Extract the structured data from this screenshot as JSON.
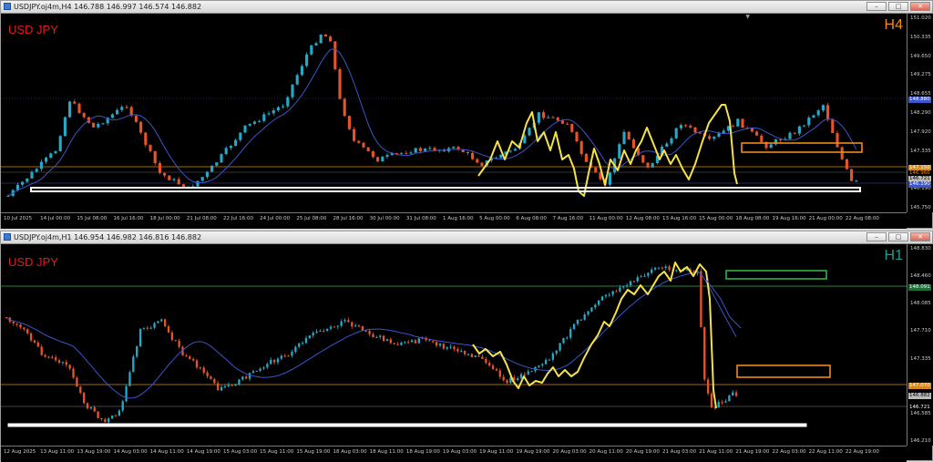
{
  "colors": {
    "bull": "#26a9c9",
    "bear": "#e8542a",
    "ma": "#3b55c8",
    "zigzag": "#f5e14a",
    "support": "#ffffff",
    "orange_box": "#f08a1c",
    "green_box": "#2fb24a",
    "orange_line": "#d7891f",
    "blue_label": "#3a55d0",
    "gray_label": "#bbbbbb"
  },
  "icons": {
    "window": "chart-window-icon",
    "minimize": "minimize-icon",
    "maximize": "maximize-icon",
    "close": "close-icon"
  },
  "top_window": {
    "title": "USDJPY.oj4m,H4  146.788 146.997 146.574 146.882",
    "symbol": "USD JPY",
    "timeframe": "H4",
    "price_axis": [
      "151.020",
      "150.335",
      "149.650",
      "149.275",
      "148.655",
      "148.290",
      "147.920",
      "147.335",
      "146.840",
      "146.190",
      "145.750"
    ],
    "price_labels": {
      "blue": "148.880",
      "orange1": "147.150",
      "orange2": "146.966",
      "gray": "146.721",
      "blue2": "146.190"
    },
    "time_axis": [
      "10 Jul 2025",
      "14 Jul 00:00",
      "15 Jul 08:00",
      "16 Jul 16:00",
      "18 Jul 00:00",
      "21 Jul 08:00",
      "22 Jul 16:00",
      "24 Jul 00:00",
      "25 Jul 08:00",
      "28 Jul 16:00",
      "30 Jul 00:00",
      "31 Jul 08:00",
      "1 Aug 16:00",
      "5 Aug 00:00",
      "6 Aug 08:00",
      "7 Aug 16:00",
      "11 Aug 00:00",
      "12 Aug 08:00",
      "13 Aug 16:00",
      "15 Aug 00:00",
      "18 Aug 08:00",
      "19 Aug 16:00",
      "21 Aug 00:00",
      "22 Aug 08:00"
    ]
  },
  "bottom_window": {
    "title": "USDJPY.oj4m,H1  146.954 146.982 146.816 146.882",
    "symbol": "USD JPY",
    "timeframe": "H1",
    "price_axis": [
      "148.830",
      "148.460",
      "148.085",
      "147.710",
      "147.335",
      "146.960",
      "146.585",
      "146.210"
    ],
    "price_labels": {
      "green": "148.091",
      "orange": "147.070",
      "gray1": "146.882",
      "gray2": "146.721"
    },
    "time_axis": [
      "12 Aug 2025",
      "13 Aug 11:00",
      "13 Aug 19:00",
      "14 Aug 03:00",
      "14 Aug 11:00",
      "14 Aug 19:00",
      "15 Aug 03:00",
      "15 Aug 11:00",
      "15 Aug 19:00",
      "18 Aug 03:00",
      "18 Aug 11:00",
      "18 Aug 19:00",
      "19 Aug 03:00",
      "19 Aug 11:00",
      "19 Aug 19:00",
      "20 Aug 03:00",
      "20 Aug 11:00",
      "20 Aug 19:00",
      "21 Aug 03:00",
      "21 Aug 11:00",
      "21 Aug 19:00",
      "22 Aug 03:00",
      "22 Aug 11:00",
      "22 Aug 19:00"
    ]
  },
  "chart_data": [
    {
      "type": "candlestick",
      "timeframe": "H4",
      "symbol": "USD JPY",
      "x": [
        "10 Jul 2025",
        "14 Jul 00:00",
        "15 Jul 08:00",
        "16 Jul 16:00",
        "18 Jul 00:00",
        "21 Jul 08:00",
        "22 Jul 16:00",
        "24 Jul 00:00",
        "25 Jul 08:00",
        "28 Jul 16:00",
        "30 Jul 00:00",
        "31 Jul 08:00",
        "1 Aug 16:00",
        "5 Aug 00:00",
        "6 Aug 08:00",
        "7 Aug 16:00",
        "11 Aug 00:00",
        "12 Aug 08:00",
        "13 Aug 16:00",
        "15 Aug 00:00",
        "18 Aug 08:00",
        "19 Aug 16:00",
        "21 Aug 00:00",
        "22 Aug 08:00"
      ],
      "close": [
        146.3,
        147.1,
        148.6,
        148.0,
        148.4,
        147.9,
        146.6,
        146.3,
        147.2,
        147.9,
        148.5,
        150.8,
        147.6,
        147.2,
        147.4,
        147.0,
        148.1,
        147.4,
        146.2,
        147.6,
        147.2,
        147.6,
        148.7,
        146.7
      ],
      "ylim": [
        145.75,
        151.02
      ]
    },
    {
      "type": "candlestick",
      "timeframe": "H1",
      "symbol": "USD JPY",
      "x": [
        "12 Aug 2025",
        "13 Aug 11:00",
        "13 Aug 19:00",
        "14 Aug 03:00",
        "14 Aug 11:00",
        "14 Aug 19:00",
        "15 Aug 03:00",
        "15 Aug 11:00",
        "15 Aug 19:00",
        "18 Aug 03:00",
        "18 Aug 11:00",
        "18 Aug 19:00",
        "19 Aug 03:00",
        "19 Aug 11:00",
        "19 Aug 19:00",
        "20 Aug 03:00",
        "20 Aug 11:00",
        "20 Aug 19:00",
        "21 Aug 03:00",
        "21 Aug 11:00",
        "21 Aug 19:00",
        "22 Aug 03:00",
        "22 Aug 11:00",
        "22 Aug 19:00"
      ],
      "close": [
        148.1,
        147.7,
        147.3,
        146.7,
        147.1,
        147.9,
        147.5,
        147.0,
        147.3,
        147.6,
        147.9,
        147.8,
        147.7,
        147.6,
        147.5,
        147.0,
        147.3,
        147.5,
        148.2,
        148.6,
        148.9,
        148.7,
        146.7,
        146.9
      ],
      "ylim": [
        146.21,
        148.83
      ]
    }
  ]
}
